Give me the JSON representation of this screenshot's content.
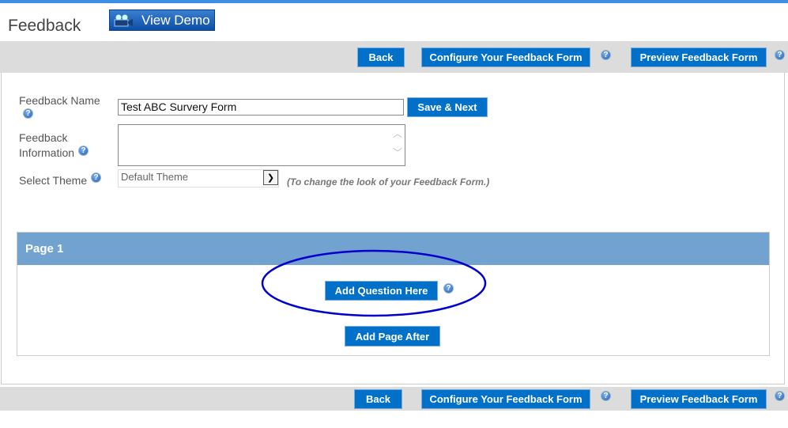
{
  "header": {
    "title": "Feedback",
    "view_demo": "View Demo"
  },
  "toolbar": {
    "back": "Back",
    "configure": "Configure Your Feedback Form",
    "preview": "Preview Feedback Form",
    "help": "?"
  },
  "form": {
    "name_label": "Feedback Name",
    "name_value": "Test ABC Survery Form",
    "save_next": "Save & Next",
    "info_label_1": "Feedback",
    "info_label_2": "Information",
    "info_value": "",
    "theme_label": "Select Theme",
    "theme_value": "Default Theme",
    "theme_note": "(To change the look of your Feedback Form.)"
  },
  "page": {
    "title": "Page 1",
    "add_question": "Add Question Here",
    "add_page_after": "Add Page After"
  },
  "colors": {
    "button": "#0070c8",
    "page_header": "#72a2d0",
    "highlight_ellipse": "#0000cc",
    "toolbar": "#dcdcdc"
  }
}
